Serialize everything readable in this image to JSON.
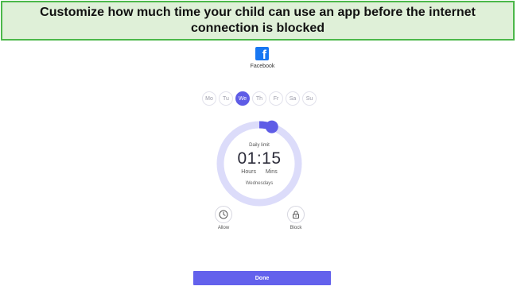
{
  "banner": {
    "text": "Customize how much time your child can use an app before the internet connection is blocked"
  },
  "app": {
    "name": "Facebook",
    "icon": "facebook-icon",
    "icon_glyph": "f",
    "brand_color": "#1877f2"
  },
  "days": [
    {
      "label": "Mo",
      "selected": false
    },
    {
      "label": "Tu",
      "selected": false
    },
    {
      "label": "We",
      "selected": true
    },
    {
      "label": "Th",
      "selected": false
    },
    {
      "label": "Fr",
      "selected": false
    },
    {
      "label": "Sa",
      "selected": false
    },
    {
      "label": "Su",
      "selected": false
    }
  ],
  "dial": {
    "label": "Daily limit",
    "time": "01:15",
    "hours_label": "Hours",
    "mins_label": "Mins",
    "day": "Wednesdays",
    "progress_fraction": 0.052,
    "track_color": "#dcdcfa",
    "accent_color": "#5e5ce6"
  },
  "actions": {
    "allow": {
      "label": "Allow",
      "icon": "clock-icon"
    },
    "block": {
      "label": "Block",
      "icon": "lock-icon"
    }
  },
  "done_button": {
    "label": "Done",
    "color": "#6361ec"
  }
}
